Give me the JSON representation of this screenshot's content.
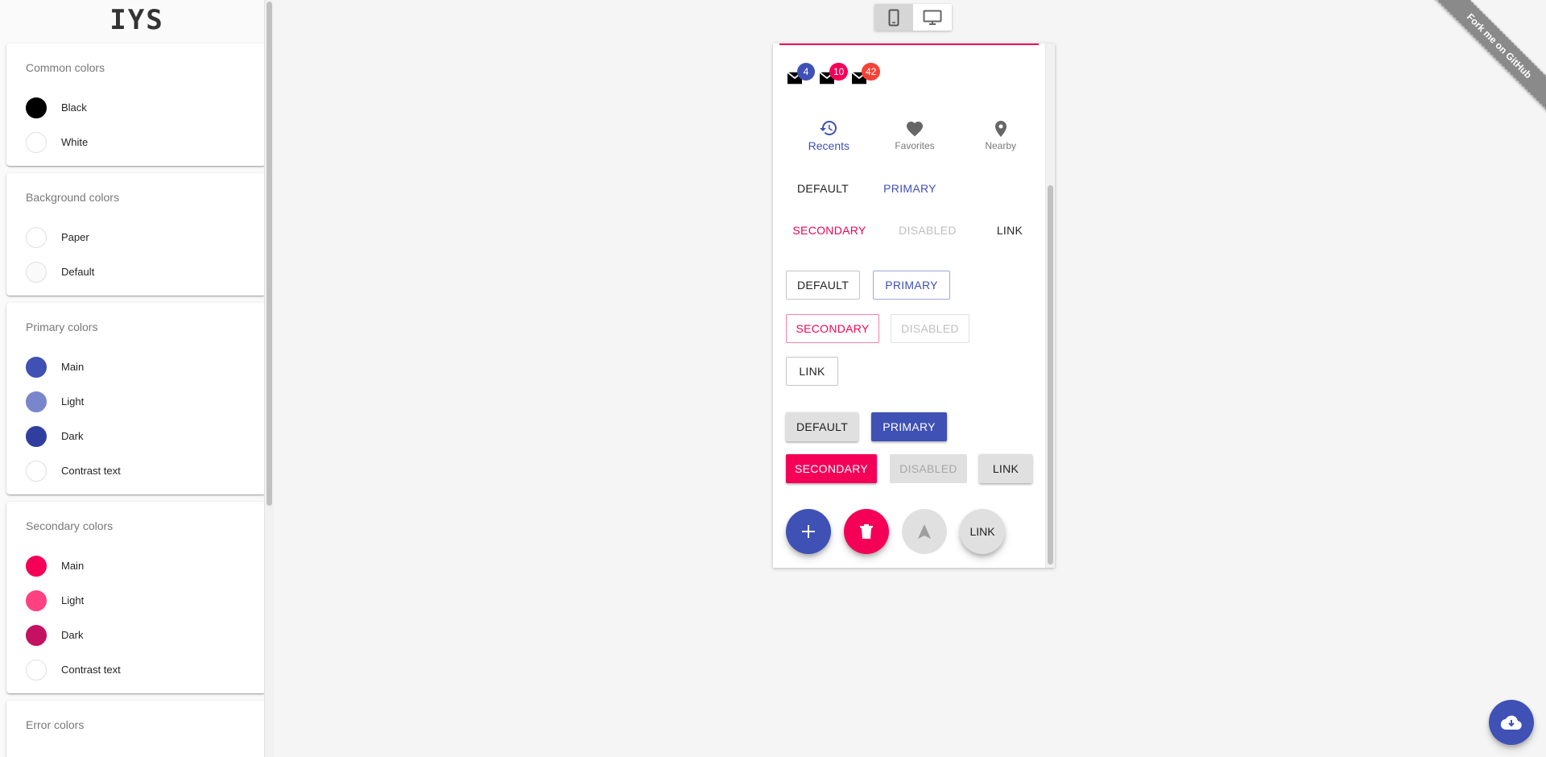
{
  "app": {
    "logo_text": "IYS"
  },
  "sidebar": {
    "groups": [
      {
        "title": "Common colors",
        "items": [
          {
            "label": "Black",
            "color": "#000000"
          },
          {
            "label": "White",
            "color": "#ffffff"
          }
        ]
      },
      {
        "title": "Background colors",
        "items": [
          {
            "label": "Paper",
            "color": "#ffffff"
          },
          {
            "label": "Default",
            "color": "#fafafa"
          }
        ]
      },
      {
        "title": "Primary colors",
        "items": [
          {
            "label": "Main",
            "color": "#3f51b5"
          },
          {
            "label": "Light",
            "color": "#7986cb"
          },
          {
            "label": "Dark",
            "color": "#303f9f"
          },
          {
            "label": "Contrast text",
            "color": "#ffffff"
          }
        ]
      },
      {
        "title": "Secondary colors",
        "items": [
          {
            "label": "Main",
            "color": "#f50057"
          },
          {
            "label": "Light",
            "color": "#ff4081"
          },
          {
            "label": "Dark",
            "color": "#c51162"
          },
          {
            "label": "Contrast text",
            "color": "#ffffff"
          }
        ]
      },
      {
        "title": "Error colors",
        "items": []
      }
    ]
  },
  "device_toggle": {
    "options": [
      "mobile-icon",
      "desktop-icon"
    ],
    "selected": "mobile"
  },
  "preview": {
    "badges": [
      {
        "count": "4",
        "color": "#3f51b5"
      },
      {
        "count": "10",
        "color": "#f50057"
      },
      {
        "count": "42",
        "color": "#f44336"
      }
    ],
    "bottom_nav": [
      {
        "label": "Recents",
        "icon": "history-icon"
      },
      {
        "label": "Favorites",
        "icon": "heart-icon"
      },
      {
        "label": "Nearby",
        "icon": "location-pin-icon"
      }
    ],
    "text_buttons": {
      "default": "DEFAULT",
      "primary": "PRIMARY",
      "secondary": "SECONDARY",
      "disabled": "DISABLED",
      "link": "LINK"
    },
    "outlined_buttons": {
      "default": "DEFAULT",
      "primary": "PRIMARY",
      "secondary": "SECONDARY",
      "disabled": "DISABLED",
      "link": "LINK"
    },
    "contained_buttons": {
      "default": "DEFAULT",
      "primary": "PRIMARY",
      "secondary": "SECONDARY",
      "disabled": "DISABLED",
      "link": "LINK"
    },
    "fabs": {
      "add_icon": "plus-icon",
      "delete_icon": "trash-icon",
      "navigation_icon": "navigation-arrow-icon",
      "link_label": "LINK"
    }
  },
  "ribbon": {
    "text": "Fork me on GitHub"
  },
  "cloud_button": {
    "icon": "cloud-download-icon"
  },
  "colors": {
    "primary": "#3f51b5",
    "secondary": "#f50057",
    "error": "#f44336"
  }
}
